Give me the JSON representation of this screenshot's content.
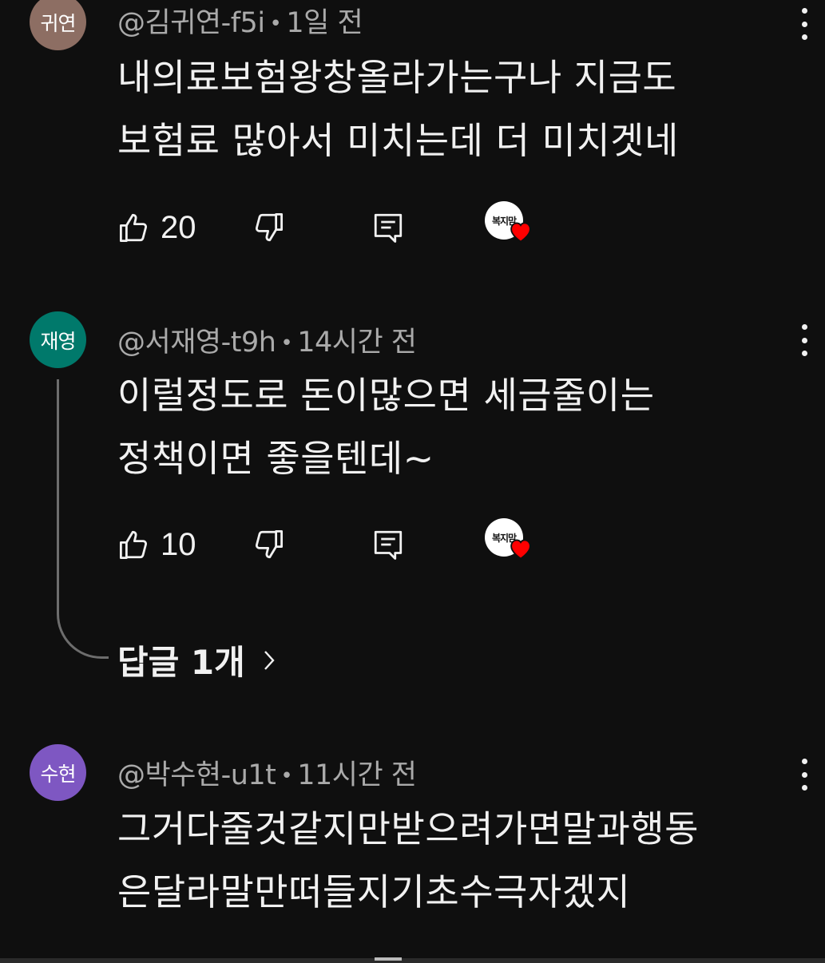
{
  "comments": [
    {
      "avatar_text": "귀연",
      "avatar_color": "#8d6e63",
      "handle": "@김귀연-f5i",
      "time": "1일 전",
      "text": "내의료보험왕창올라가는구나 지금도\n보험료 많아서 미치는데 더 미치겟네",
      "likes": "20",
      "badge_text": "복지맘"
    },
    {
      "avatar_text": "재영",
      "avatar_color": "#00796b",
      "handle": "@서재영-t9h",
      "time": "14시간 전",
      "text": "이럴정도로 돈이많으면 세금줄이는\n정책이면 좋을텐데~",
      "likes": "10",
      "badge_text": "복지맘",
      "replies_label": "답글 1개"
    },
    {
      "avatar_text": "수현",
      "avatar_color": "#7e57c2",
      "handle": "@박수현-u1t",
      "time": "11시간 전",
      "text": "그거다줄것같지만받으려가면말과행동\n은달라말만떠들지기초수극자겠지"
    }
  ],
  "separator": "•",
  "icons": {
    "like": "thumb-up-icon",
    "dislike": "thumb-down-icon",
    "reply": "reply-icon",
    "more": "more-vert-icon",
    "chevron": "chevron-right-icon",
    "heart": "creator-heart-icon"
  },
  "colors": {
    "background": "#0f0f0f",
    "text": "#f1f1f1",
    "meta": "#aaaaaa",
    "heart": "#ff0000"
  }
}
